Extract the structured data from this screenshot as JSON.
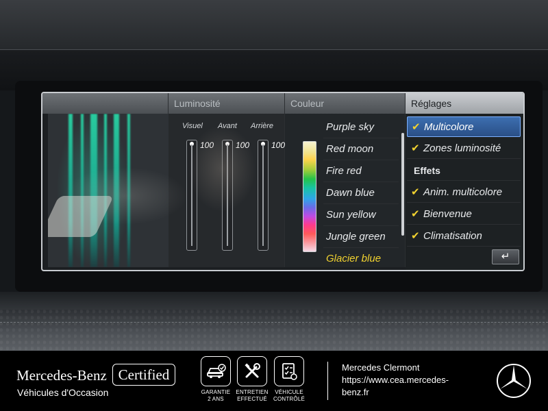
{
  "screen": {
    "headers": {
      "luminosite": "Luminosité",
      "couleur": "Couleur",
      "reglages": "Réglages"
    },
    "sliders": [
      {
        "label": "Visuel",
        "value": "100",
        "level": 1.0
      },
      {
        "label": "Avant",
        "value": "100",
        "level": 1.0
      },
      {
        "label": "Arrière",
        "value": "100",
        "level": 1.0
      }
    ],
    "colors": [
      {
        "label": "Purple sky"
      },
      {
        "label": "Red moon"
      },
      {
        "label": "Fire red"
      },
      {
        "label": "Dawn blue"
      },
      {
        "label": "Sun yellow"
      },
      {
        "label": "Jungle green"
      },
      {
        "label": "Glacier blue",
        "selected": true
      }
    ],
    "settings": {
      "multicolore": "Multicolore",
      "zones": "Zones luminosité",
      "effets_heading": "Effets",
      "anim": "Anim. multicolore",
      "bienvenue": "Bienvenue",
      "climatisation": "Climatisation",
      "back_icon": "↵"
    },
    "accent_color": "#f1d230",
    "focus_color": "#3c6eb0"
  },
  "footer": {
    "brand": "Mercedes-Benz",
    "certified": "Certified",
    "subtitle": "Véhicules d'Occasion",
    "badges": [
      {
        "icon": "car-check-icon",
        "label": "GARANTIE\n2 ANS"
      },
      {
        "icon": "tools-icon",
        "label": "ENTRETIEN\nEFFECTUÉ"
      },
      {
        "icon": "checklist-icon",
        "label": "VÉHICULE\nCONTRÔLÉ"
      }
    ],
    "dealer_name": "Mercedes Clermont",
    "dealer_url_1": "https://www.cea.mercedes-",
    "dealer_url_2": "benz.fr"
  }
}
